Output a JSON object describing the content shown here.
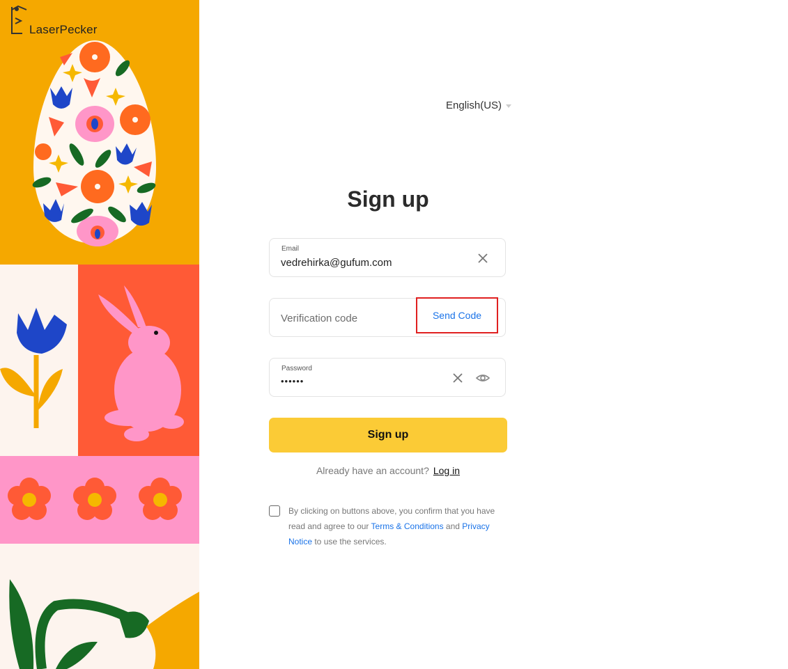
{
  "brand": {
    "name": "LaserPecker"
  },
  "header": {
    "language": "English(US)"
  },
  "form": {
    "title": "Sign up",
    "email": {
      "label": "Email",
      "value": "vedrehirka@gufum.com"
    },
    "verification": {
      "placeholder": "Verification code",
      "send_label": "Send Code"
    },
    "password": {
      "label": "Password",
      "value": "••••••"
    },
    "submit_label": "Sign up",
    "login_prompt": "Already have an account?",
    "login_link": "Log in"
  },
  "agreement": {
    "text_before": "By clicking on buttons above, you confirm that you have read and agree to our ",
    "terms_link": "Terms & Conditions",
    "text_middle": " and ",
    "privacy_link": "Privacy Notice",
    "text_after": " to use the services."
  },
  "colors": {
    "accent": "#fbcb36",
    "link": "#1a73e8",
    "highlight_border": "#e02020",
    "panel_orange": "#f5a800",
    "panel_red": "#ff5a36",
    "panel_pink": "#ff96c8"
  },
  "icons": [
    "clear-icon",
    "eye-icon",
    "chevron-down-icon",
    "checkbox-icon"
  ]
}
